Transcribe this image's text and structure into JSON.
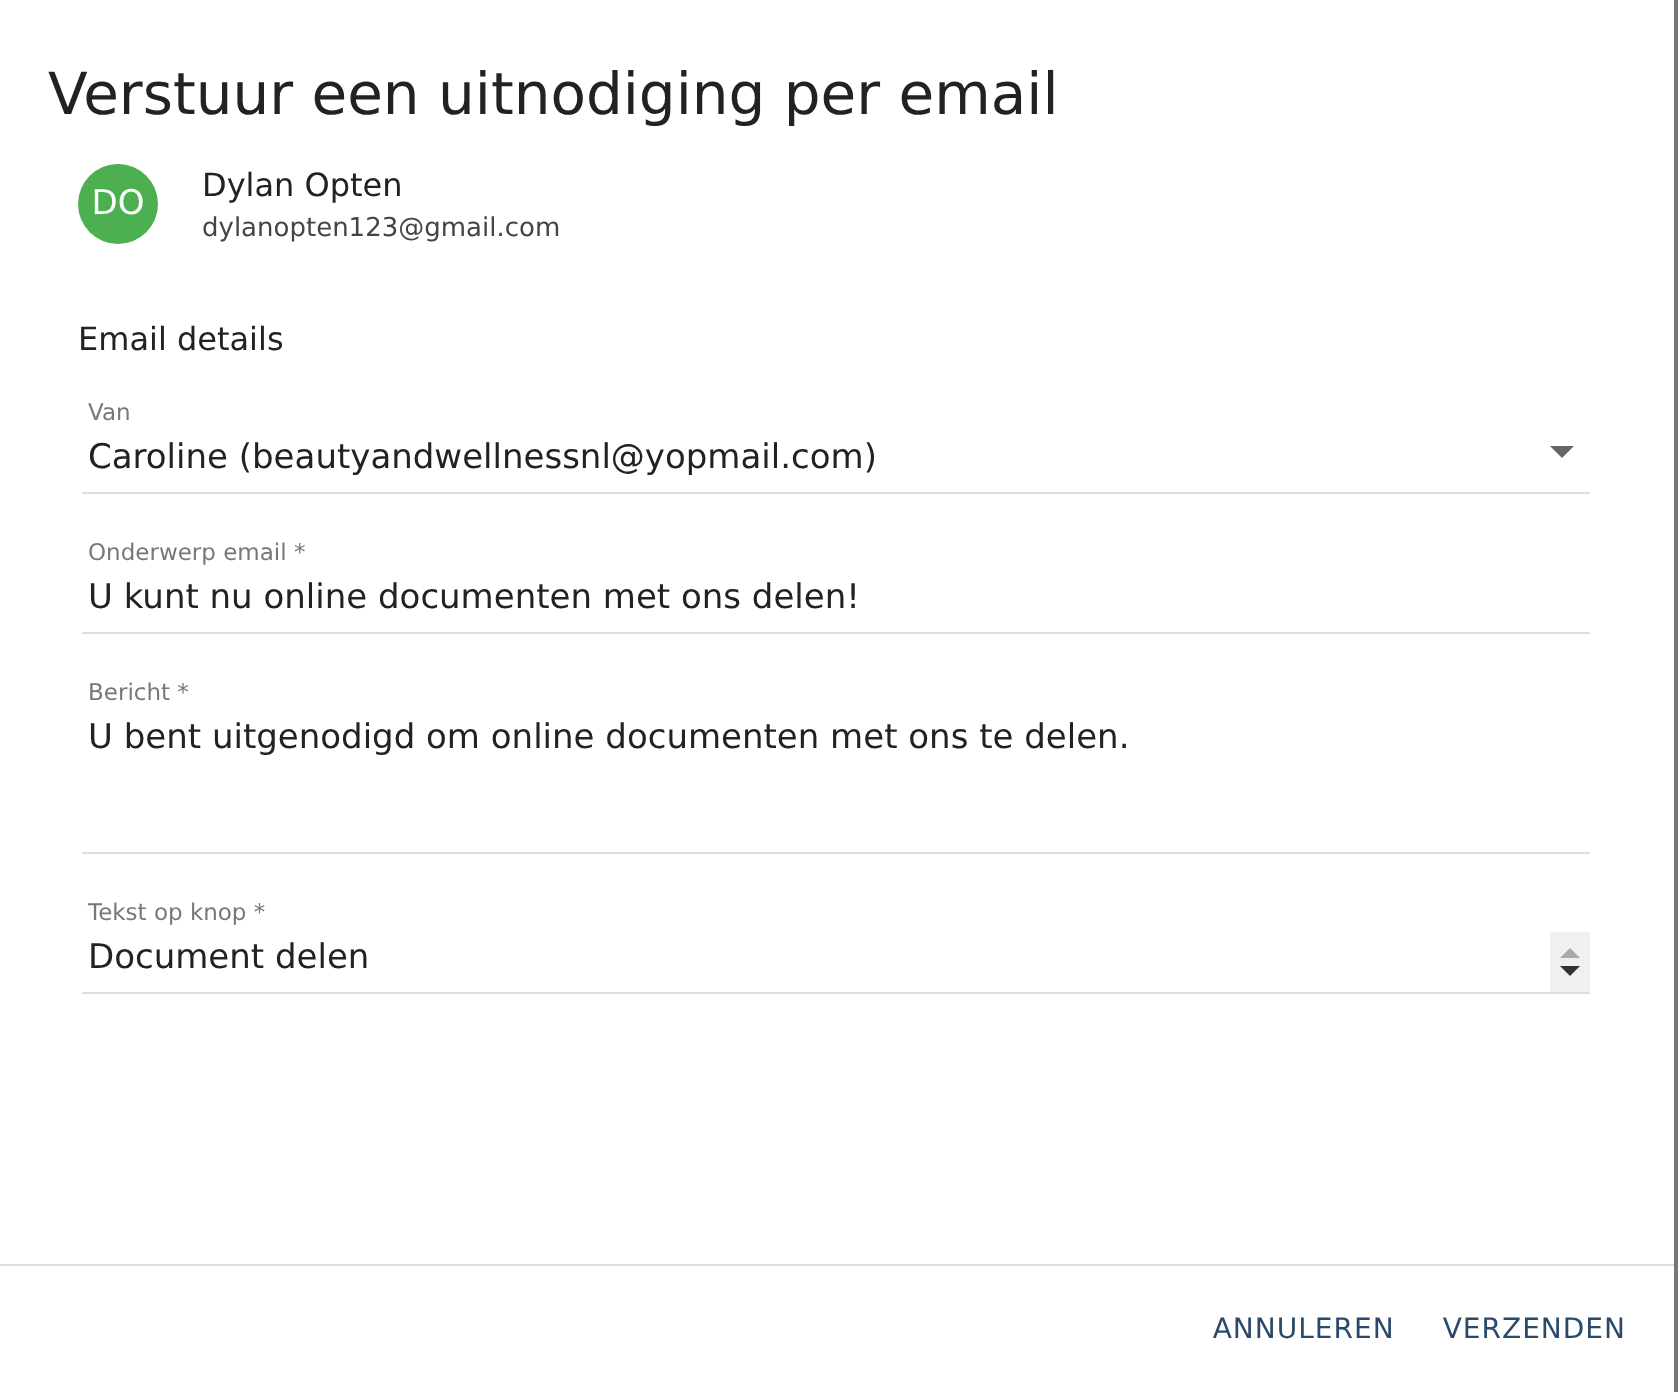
{
  "dialog": {
    "title": "Verstuur een uitnodiging per email"
  },
  "recipient": {
    "initials": "DO",
    "color": "#4caf50",
    "name": "Dylan Opten",
    "email": "dylanopten123@gmail.com"
  },
  "section_title": "Email details",
  "fields": [
    {
      "kind": "select",
      "label": "Van",
      "value": "Caroline (beautyandwellnessnl@yopmail.com)"
    },
    {
      "kind": "text",
      "label": "Onderwerp email *",
      "value": "U kunt nu online documenten met ons delen!"
    },
    {
      "kind": "textarea",
      "label": "Bericht *",
      "value": "U bent uitgenodigd om online documenten met ons te delen."
    },
    {
      "kind": "number",
      "label": "Tekst op knop *",
      "value": "Document delen"
    }
  ],
  "buttons": [
    "ANNULEREN",
    "VERZENDEN"
  ]
}
